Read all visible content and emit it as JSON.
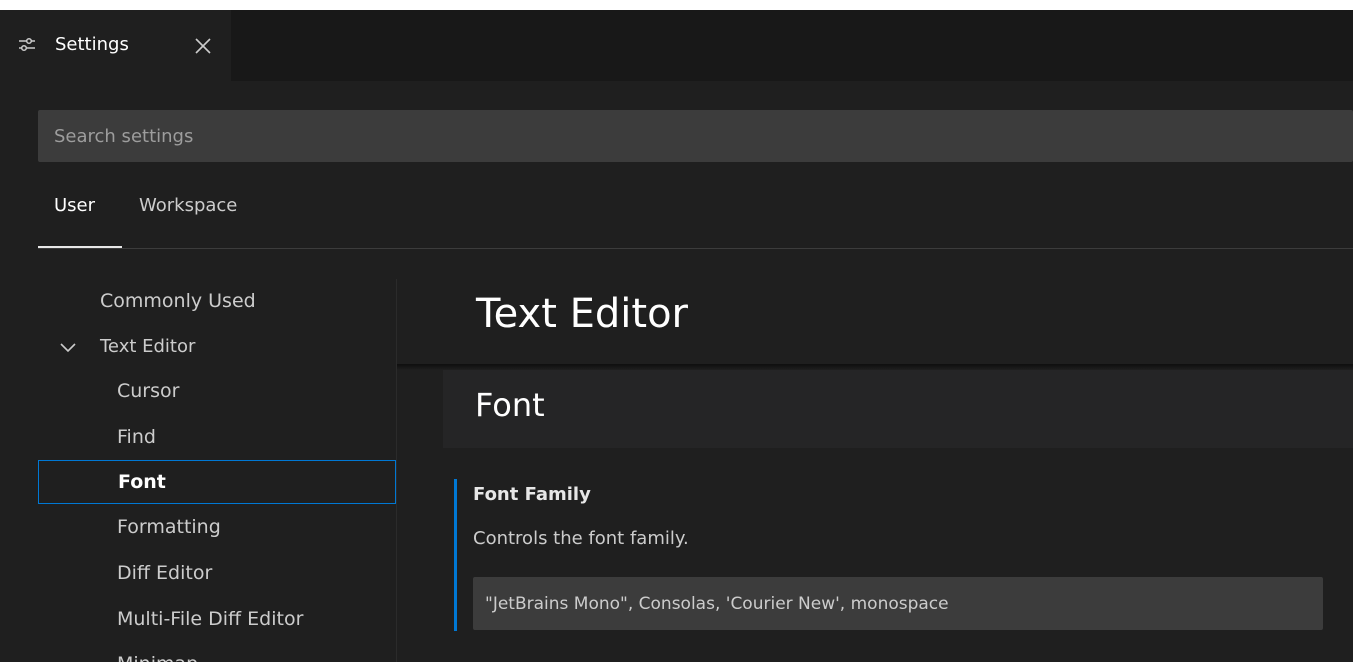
{
  "tab": {
    "title": "Settings",
    "icon": "settings-sliders-icon",
    "close_icon": "close-icon"
  },
  "search": {
    "placeholder": "Search settings",
    "value": ""
  },
  "scope_tabs": {
    "user": "User",
    "workspace": "Workspace",
    "active": "User"
  },
  "toc": {
    "items": [
      {
        "label": "Commonly Used",
        "level": 1
      },
      {
        "label": "Text Editor",
        "level": 1,
        "expanded": true
      },
      {
        "label": "Cursor",
        "level": 2
      },
      {
        "label": "Find",
        "level": 2
      },
      {
        "label": "Font",
        "level": 2,
        "selected": true
      },
      {
        "label": "Formatting",
        "level": 2
      },
      {
        "label": "Diff Editor",
        "level": 2
      },
      {
        "label": "Multi-File Diff Editor",
        "level": 2
      },
      {
        "label": "Minimap",
        "level": 2
      }
    ]
  },
  "content": {
    "section_title": "Text Editor",
    "group_title": "Font",
    "setting": {
      "title": "Font Family",
      "description": "Controls the font family.",
      "value": "\"JetBrains Mono\", Consolas, 'Courier New', monospace"
    }
  },
  "colors": {
    "background": "#1f1f1f",
    "tabbar": "#181818",
    "input_bg": "#3c3c3c",
    "accent": "#0078d4"
  }
}
